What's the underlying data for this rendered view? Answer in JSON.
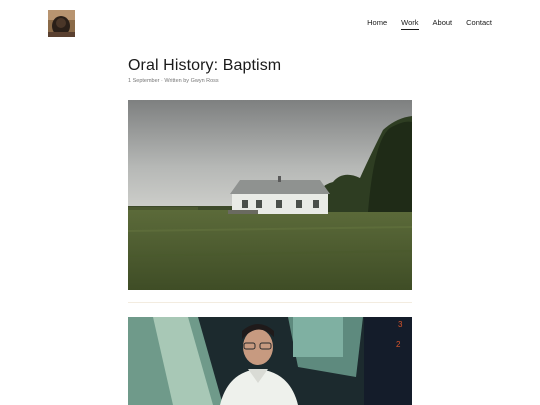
{
  "header": {
    "logo_alt": "avatar",
    "nav": [
      {
        "label": "Home",
        "active": false
      },
      {
        "label": "Work",
        "active": true
      },
      {
        "label": "About",
        "active": false
      },
      {
        "label": "Contact",
        "active": false
      }
    ]
  },
  "post": {
    "title": "Oral History: Baptism",
    "meta": "1 September · Written by Gwyn Ross"
  },
  "images": [
    {
      "name": "white-farmhouse-in-field-photo"
    },
    {
      "name": "man-with-glasses-portrait-photo"
    }
  ]
}
